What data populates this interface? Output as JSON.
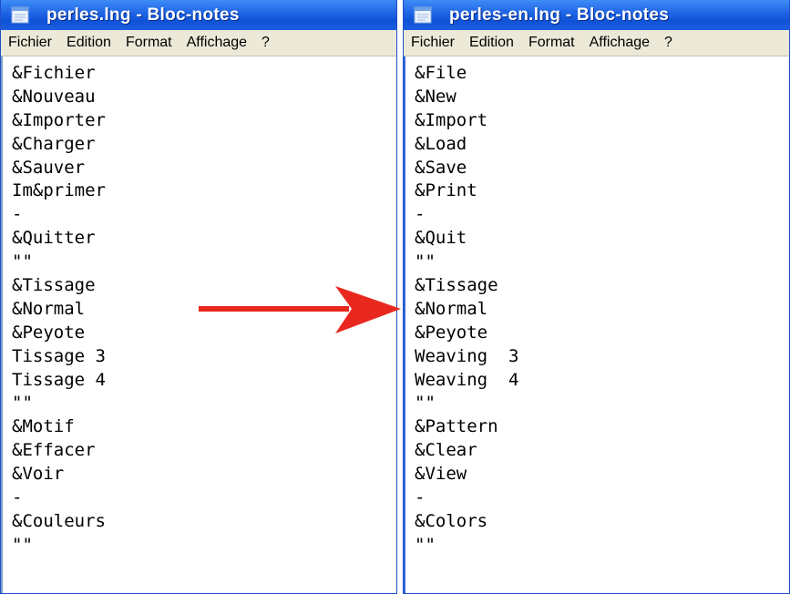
{
  "left_window": {
    "title": "perles.lng - Bloc-notes",
    "menu": [
      "Fichier",
      "Edition",
      "Format",
      "Affichage",
      "?"
    ],
    "lines": [
      "&Fichier",
      "&Nouveau",
      "&Importer",
      "&Charger",
      "&Sauver",
      "Im&primer",
      "-",
      "&Quitter",
      "\"\"",
      "&Tissage",
      "&Normal",
      "&Peyote",
      "Tissage 3",
      "Tissage 4",
      "\"\"",
      "&Motif",
      "&Effacer",
      "&Voir",
      "-",
      "&Couleurs",
      "\"\""
    ]
  },
  "right_window": {
    "title": "perles-en.lng - Bloc-notes",
    "menu": [
      "Fichier",
      "Edition",
      "Format",
      "Affichage",
      "?"
    ],
    "lines": [
      "&File",
      "&New",
      "&Import",
      "&Load",
      "&Save",
      "&Print",
      "-",
      "&Quit",
      "\"\"",
      "&Tissage",
      "&Normal",
      "&Peyote",
      "Weaving  3",
      "Weaving  4",
      "\"\"",
      "&Pattern",
      "&Clear",
      "&View",
      "-",
      "&Colors",
      "\"\""
    ]
  },
  "colors": {
    "titlebar": "#1d63e4",
    "menubar": "#ece9d8",
    "arrow": "#e8281e"
  },
  "icons": {
    "window_icon": "notepad-icon",
    "arrow": "right-arrow"
  }
}
